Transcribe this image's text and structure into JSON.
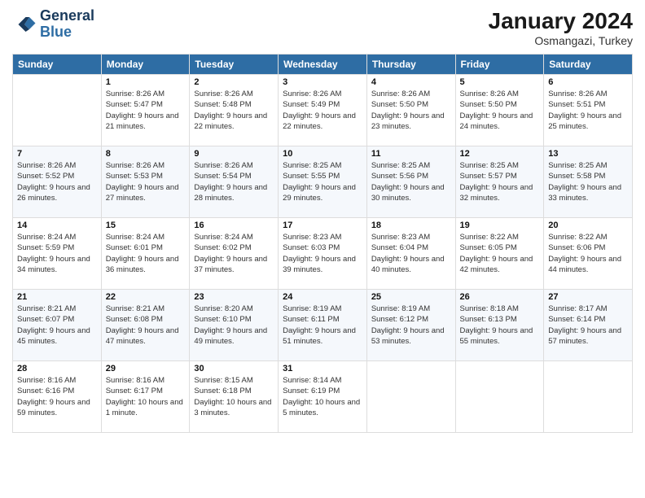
{
  "logo": {
    "line1": "General",
    "line2": "Blue"
  },
  "title": "January 2024",
  "location": "Osmangazi, Turkey",
  "header_days": [
    "Sunday",
    "Monday",
    "Tuesday",
    "Wednesday",
    "Thursday",
    "Friday",
    "Saturday"
  ],
  "weeks": [
    [
      {
        "day": "",
        "sunrise": "",
        "sunset": "",
        "daylight": ""
      },
      {
        "day": "1",
        "sunrise": "Sunrise: 8:26 AM",
        "sunset": "Sunset: 5:47 PM",
        "daylight": "Daylight: 9 hours and 21 minutes."
      },
      {
        "day": "2",
        "sunrise": "Sunrise: 8:26 AM",
        "sunset": "Sunset: 5:48 PM",
        "daylight": "Daylight: 9 hours and 22 minutes."
      },
      {
        "day": "3",
        "sunrise": "Sunrise: 8:26 AM",
        "sunset": "Sunset: 5:49 PM",
        "daylight": "Daylight: 9 hours and 22 minutes."
      },
      {
        "day": "4",
        "sunrise": "Sunrise: 8:26 AM",
        "sunset": "Sunset: 5:50 PM",
        "daylight": "Daylight: 9 hours and 23 minutes."
      },
      {
        "day": "5",
        "sunrise": "Sunrise: 8:26 AM",
        "sunset": "Sunset: 5:50 PM",
        "daylight": "Daylight: 9 hours and 24 minutes."
      },
      {
        "day": "6",
        "sunrise": "Sunrise: 8:26 AM",
        "sunset": "Sunset: 5:51 PM",
        "daylight": "Daylight: 9 hours and 25 minutes."
      }
    ],
    [
      {
        "day": "7",
        "sunrise": "Sunrise: 8:26 AM",
        "sunset": "Sunset: 5:52 PM",
        "daylight": "Daylight: 9 hours and 26 minutes."
      },
      {
        "day": "8",
        "sunrise": "Sunrise: 8:26 AM",
        "sunset": "Sunset: 5:53 PM",
        "daylight": "Daylight: 9 hours and 27 minutes."
      },
      {
        "day": "9",
        "sunrise": "Sunrise: 8:26 AM",
        "sunset": "Sunset: 5:54 PM",
        "daylight": "Daylight: 9 hours and 28 minutes."
      },
      {
        "day": "10",
        "sunrise": "Sunrise: 8:25 AM",
        "sunset": "Sunset: 5:55 PM",
        "daylight": "Daylight: 9 hours and 29 minutes."
      },
      {
        "day": "11",
        "sunrise": "Sunrise: 8:25 AM",
        "sunset": "Sunset: 5:56 PM",
        "daylight": "Daylight: 9 hours and 30 minutes."
      },
      {
        "day": "12",
        "sunrise": "Sunrise: 8:25 AM",
        "sunset": "Sunset: 5:57 PM",
        "daylight": "Daylight: 9 hours and 32 minutes."
      },
      {
        "day": "13",
        "sunrise": "Sunrise: 8:25 AM",
        "sunset": "Sunset: 5:58 PM",
        "daylight": "Daylight: 9 hours and 33 minutes."
      }
    ],
    [
      {
        "day": "14",
        "sunrise": "Sunrise: 8:24 AM",
        "sunset": "Sunset: 5:59 PM",
        "daylight": "Daylight: 9 hours and 34 minutes."
      },
      {
        "day": "15",
        "sunrise": "Sunrise: 8:24 AM",
        "sunset": "Sunset: 6:01 PM",
        "daylight": "Daylight: 9 hours and 36 minutes."
      },
      {
        "day": "16",
        "sunrise": "Sunrise: 8:24 AM",
        "sunset": "Sunset: 6:02 PM",
        "daylight": "Daylight: 9 hours and 37 minutes."
      },
      {
        "day": "17",
        "sunrise": "Sunrise: 8:23 AM",
        "sunset": "Sunset: 6:03 PM",
        "daylight": "Daylight: 9 hours and 39 minutes."
      },
      {
        "day": "18",
        "sunrise": "Sunrise: 8:23 AM",
        "sunset": "Sunset: 6:04 PM",
        "daylight": "Daylight: 9 hours and 40 minutes."
      },
      {
        "day": "19",
        "sunrise": "Sunrise: 8:22 AM",
        "sunset": "Sunset: 6:05 PM",
        "daylight": "Daylight: 9 hours and 42 minutes."
      },
      {
        "day": "20",
        "sunrise": "Sunrise: 8:22 AM",
        "sunset": "Sunset: 6:06 PM",
        "daylight": "Daylight: 9 hours and 44 minutes."
      }
    ],
    [
      {
        "day": "21",
        "sunrise": "Sunrise: 8:21 AM",
        "sunset": "Sunset: 6:07 PM",
        "daylight": "Daylight: 9 hours and 45 minutes."
      },
      {
        "day": "22",
        "sunrise": "Sunrise: 8:21 AM",
        "sunset": "Sunset: 6:08 PM",
        "daylight": "Daylight: 9 hours and 47 minutes."
      },
      {
        "day": "23",
        "sunrise": "Sunrise: 8:20 AM",
        "sunset": "Sunset: 6:10 PM",
        "daylight": "Daylight: 9 hours and 49 minutes."
      },
      {
        "day": "24",
        "sunrise": "Sunrise: 8:19 AM",
        "sunset": "Sunset: 6:11 PM",
        "daylight": "Daylight: 9 hours and 51 minutes."
      },
      {
        "day": "25",
        "sunrise": "Sunrise: 8:19 AM",
        "sunset": "Sunset: 6:12 PM",
        "daylight": "Daylight: 9 hours and 53 minutes."
      },
      {
        "day": "26",
        "sunrise": "Sunrise: 8:18 AM",
        "sunset": "Sunset: 6:13 PM",
        "daylight": "Daylight: 9 hours and 55 minutes."
      },
      {
        "day": "27",
        "sunrise": "Sunrise: 8:17 AM",
        "sunset": "Sunset: 6:14 PM",
        "daylight": "Daylight: 9 hours and 57 minutes."
      }
    ],
    [
      {
        "day": "28",
        "sunrise": "Sunrise: 8:16 AM",
        "sunset": "Sunset: 6:16 PM",
        "daylight": "Daylight: 9 hours and 59 minutes."
      },
      {
        "day": "29",
        "sunrise": "Sunrise: 8:16 AM",
        "sunset": "Sunset: 6:17 PM",
        "daylight": "Daylight: 10 hours and 1 minute."
      },
      {
        "day": "30",
        "sunrise": "Sunrise: 8:15 AM",
        "sunset": "Sunset: 6:18 PM",
        "daylight": "Daylight: 10 hours and 3 minutes."
      },
      {
        "day": "31",
        "sunrise": "Sunrise: 8:14 AM",
        "sunset": "Sunset: 6:19 PM",
        "daylight": "Daylight: 10 hours and 5 minutes."
      },
      {
        "day": "",
        "sunrise": "",
        "sunset": "",
        "daylight": ""
      },
      {
        "day": "",
        "sunrise": "",
        "sunset": "",
        "daylight": ""
      },
      {
        "day": "",
        "sunrise": "",
        "sunset": "",
        "daylight": ""
      }
    ]
  ]
}
